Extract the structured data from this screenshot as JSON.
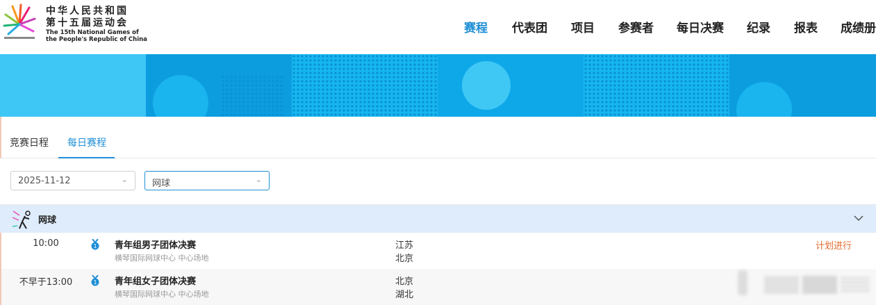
{
  "logo": {
    "title_cn_1": "中华人民共和国",
    "title_cn_2": "第十五届运动会",
    "title_en_1": "The 15th National Games of",
    "title_en_2": "the People's Republic of China"
  },
  "nav": [
    "赛程",
    "代表团",
    "项目",
    "参赛者",
    "每日决赛",
    "纪录",
    "报表",
    "成绩册"
  ],
  "tabs": [
    "竞赛日程",
    "每日赛程"
  ],
  "filters": {
    "date": "2025-11-12",
    "sport": "网球"
  },
  "sport_section": {
    "name": "网球"
  },
  "rows": [
    {
      "time": "10:00",
      "event": "青年组男子团体决赛",
      "venue": "横琴国际网球中心 中心场地",
      "team1": "江苏",
      "team2": "北京",
      "status": "计划进行"
    },
    {
      "time": "不早于13:00",
      "event": "青年组女子团体决赛",
      "venue": "横琴国际网球中心 中心场地",
      "team1": "北京",
      "team2": "湖北",
      "status": ""
    }
  ],
  "colors": {
    "accent": "#1e8fd6",
    "status": "#e5692a",
    "section_bg": "#deecfb"
  }
}
